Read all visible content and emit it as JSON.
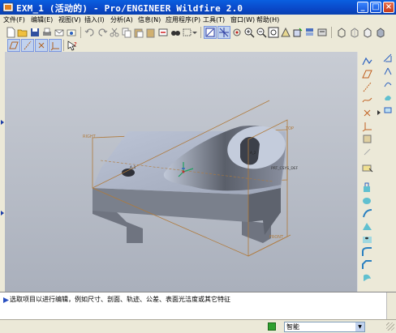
{
  "window": {
    "title": "EXM_1 (活动的) - Pro/ENGINEER Wildfire 2.0",
    "minimize": "_",
    "maximize": "□",
    "close": "×"
  },
  "menu": [
    "文件(F)",
    "编辑(E)",
    "视图(V)",
    "插入(I)",
    "分析(A)",
    "信息(N)",
    "应用程序(P)",
    "工具(T)",
    "窗口(W)",
    "帮助(H)"
  ],
  "graphics": {
    "datum_labels": {
      "top": "TOP",
      "right": "RIGHT",
      "front": "FRONT",
      "a1": "A_1",
      "a2": "A_2",
      "csys": "PRT_CSYS_DEF"
    }
  },
  "message": {
    "text": "选取项目以进行编辑，例如尺寸、剖面、轨迹、公差、表面光洁度或其它特征"
  },
  "status": {
    "filter": "智能"
  },
  "colors": {
    "titlebar": "#0a48c8",
    "model_top": "#b8c0d2",
    "model_side": "#6f7480",
    "datum": "#b07a3a",
    "csys": "#20a060"
  }
}
